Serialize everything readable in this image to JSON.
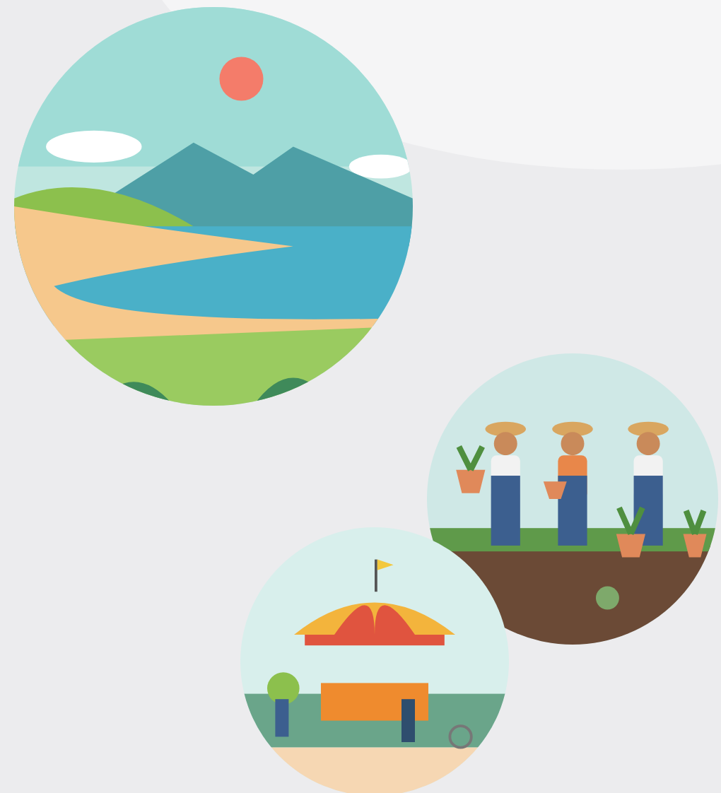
{
  "illustrations": [
    {
      "kind": "coast"
    },
    {
      "kind": "gardeners"
    },
    {
      "kind": "market"
    }
  ]
}
